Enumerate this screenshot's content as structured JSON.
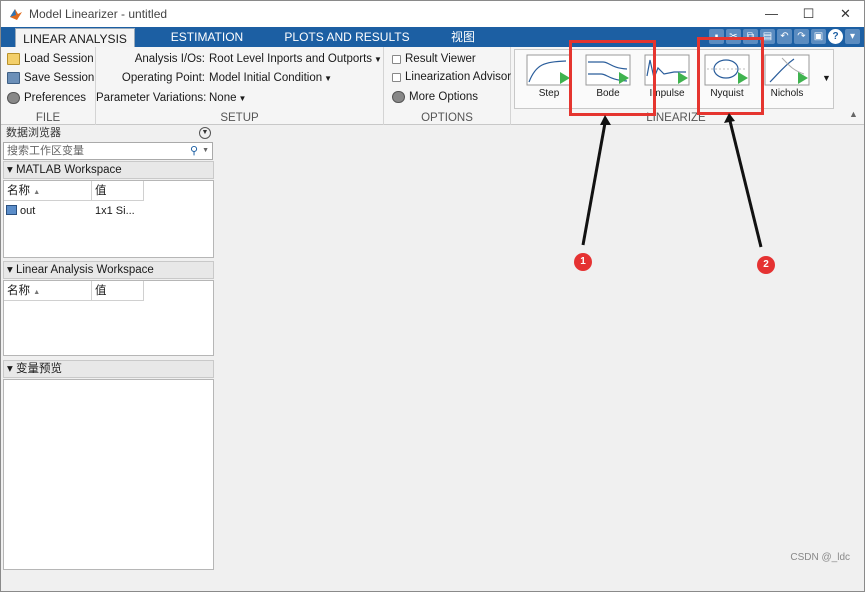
{
  "window": {
    "title": "Model Linearizer - untitled",
    "controls": [
      "—",
      "☐",
      "✕"
    ]
  },
  "tabs": [
    {
      "label": "LINEAR ANALYSIS",
      "active": true
    },
    {
      "label": "ESTIMATION",
      "active": false
    },
    {
      "label": "PLOTS AND RESULTS",
      "active": false
    },
    {
      "label": "视图",
      "active": false
    }
  ],
  "ribbon": {
    "file": {
      "section_label": "FILE",
      "load_session": "Load Session",
      "save_session": "Save Session",
      "preferences": "Preferences"
    },
    "setup": {
      "section_label": "SETUP",
      "analysis_ios_label": "Analysis I/Os:",
      "analysis_ios_value": "Root Level Inports and Outports",
      "operating_point_label": "Operating Point:",
      "operating_point_value": "Model Initial Condition",
      "param_variations_label": "Parameter Variations:",
      "param_variations_value": "None"
    },
    "options": {
      "section_label": "OPTIONS",
      "result_viewer": "Result Viewer",
      "linearization_advisor": "Linearization Advisor",
      "more_options": "More Options"
    },
    "linearize": {
      "section_label": "LINEARIZE",
      "plots": [
        "Step",
        "Bode",
        "Impulse",
        "Nyquist",
        "Nichols"
      ]
    }
  },
  "annotations": {
    "marker_1": "1",
    "marker_2": "2",
    "highlight_color": "#e5352f"
  },
  "browser": {
    "header": "数据浏览器",
    "search_placeholder": "搜索工作区变量",
    "matlab_workspace": {
      "title": "MATLAB Workspace",
      "col_name": "名称",
      "col_value": "值",
      "rows": [
        {
          "name": "out",
          "value": "1x1 Si..."
        }
      ]
    },
    "linear_workspace": {
      "title": "Linear Analysis Workspace",
      "col_name": "名称",
      "col_value": "值"
    },
    "preview": {
      "title": "变量预览"
    }
  },
  "watermark": "CSDN @_ldc"
}
